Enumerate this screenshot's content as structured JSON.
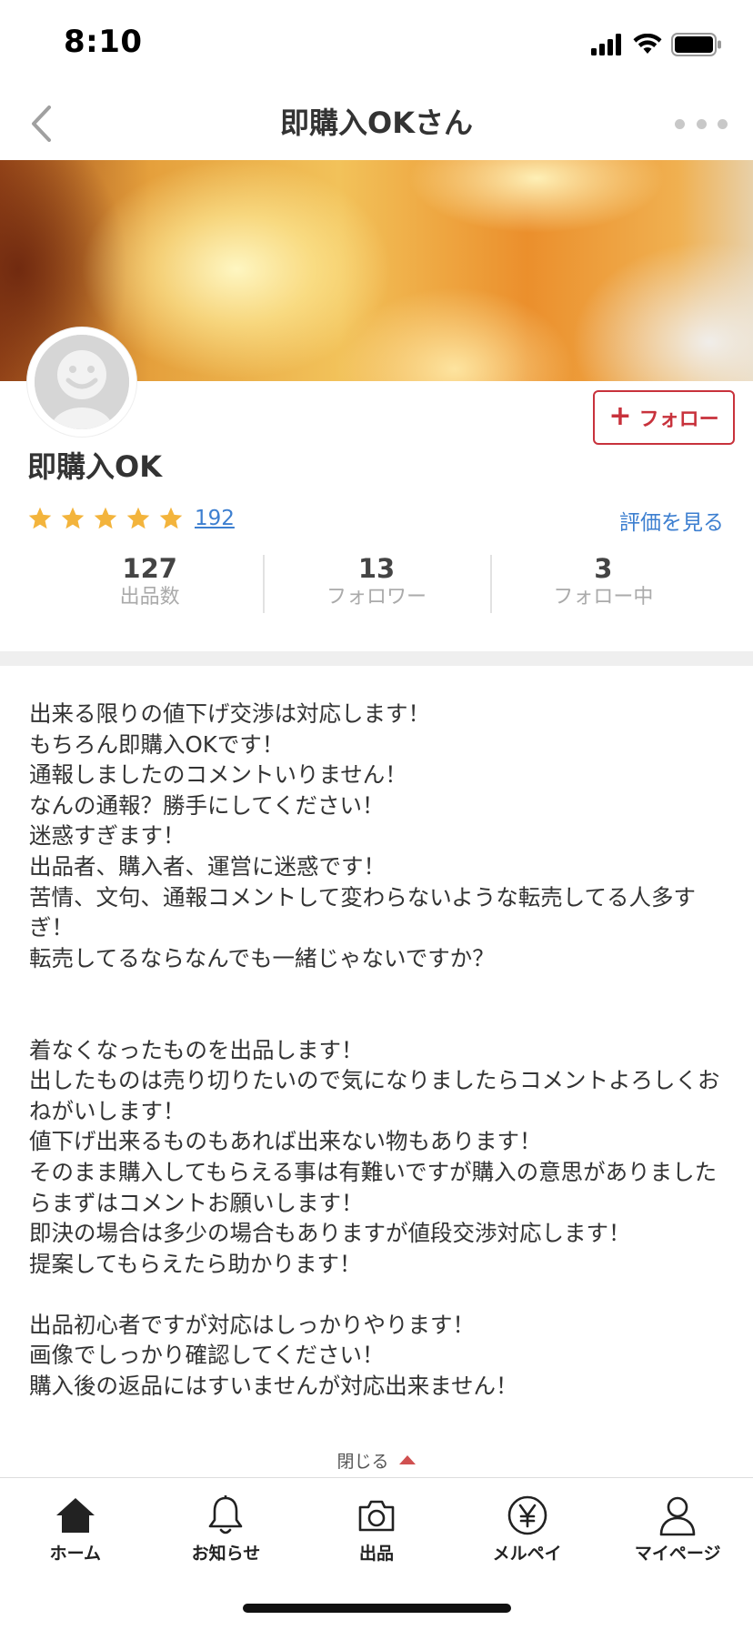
{
  "status_bar": {
    "time": "8:10"
  },
  "nav": {
    "title": "即購入OKさん"
  },
  "profile": {
    "name": "即購入OK",
    "follow_label": "フォロー",
    "rating_stars": 5,
    "rating_count": "192",
    "see_reviews": "評価を見る"
  },
  "stats": [
    {
      "value": "127",
      "label": "出品数"
    },
    {
      "value": "13",
      "label": "フォロワー"
    },
    {
      "value": "3",
      "label": "フォロー中"
    }
  ],
  "bio": "出来る限りの値下げ交渉は対応します！\nもちろん即購入OKです！\n通報しましたのコメントいりません！\nなんの通報？勝手にしてください！\n迷惑すぎます！\n出品者、購入者、運営に迷惑です！\n苦情、文句、通報コメントして変わらないような転売してる人多すぎ！\n転売してるならなんでも一緒じゃないですか？\n\n\n着なくなったものを出品します！\n出したものは売り切りたいので気になりましたらコメントよろしくおねがいします！\n値下げ出来るものもあれば出来ない物もあります！\nそのまま購入してもらえる事は有難いですが購入の意思がありましたらまずはコメントお願いします！\n即決の場合は多少の場合もありますが値段交渉対応します！\n提案してもらえたら助かります！\n\n出品初心者ですが対応はしっかりやります！\n画像でしっかり確認してください！\n購入後の返品にはすいませんが対応出来ません！",
  "close_label": "閉じる",
  "tabs": [
    {
      "label": "ホーム",
      "icon": "home-icon"
    },
    {
      "label": "お知らせ",
      "icon": "bell-icon"
    },
    {
      "label": "出品",
      "icon": "camera-icon"
    },
    {
      "label": "メルペイ",
      "icon": "yen-icon"
    },
    {
      "label": "マイページ",
      "icon": "person-icon"
    }
  ],
  "colors": {
    "accent": "#c8323c",
    "link": "#3d7fd0",
    "star": "#f3b43c"
  }
}
